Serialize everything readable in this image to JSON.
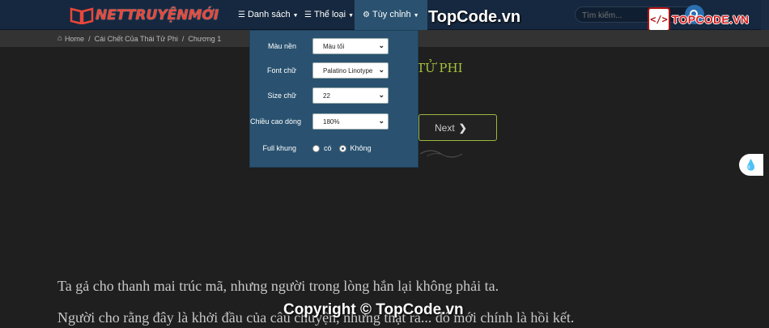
{
  "header": {
    "logo_text": "NETTRUYỆNMỚI",
    "nav": [
      {
        "label": "Danh sách",
        "icon": "list-icon"
      },
      {
        "label": "Thể loại",
        "icon": "list-icon"
      },
      {
        "label": "Tùy chỉnh",
        "icon": "gear-icon"
      }
    ],
    "watermark": "TopCode.vn",
    "search_placeholder": "Tìm kiếm...",
    "brand_badge": "TOPCODE.VN",
    "brand_icon": "</>"
  },
  "breadcrumb": {
    "items": [
      "Home",
      "Cái Chết Của Thái Tử Phi",
      "Chương 1"
    ],
    "separator": "/"
  },
  "settings_panel": {
    "rows": [
      {
        "label": "Màu nền",
        "value": "Màu tối"
      },
      {
        "label": "Font chữ",
        "value": "Palatino Linotype"
      },
      {
        "label": "Size chữ",
        "value": "22"
      },
      {
        "label": "Chiều cao dòng",
        "value": "180%"
      }
    ],
    "full_frame": {
      "label": "Full khung",
      "options": [
        "có",
        "Không"
      ],
      "selected": "Không"
    }
  },
  "content": {
    "title_visible": "TỬ PHI",
    "next_label": "Next",
    "paragraphs": [
      "Ta gả cho thanh mai trúc mã, nhưng người trong lòng hắn lại không phải ta.",
      "Người cho rằng đây là khởi đầu của câu chuyện, nhưng thật ra... đó mới chính là hồi kết."
    ],
    "copyright": "Copyright © TopCode.vn"
  },
  "colors": {
    "nav_bg": "#16283f",
    "panel_bg": "#2a5270",
    "title_accent": "#a6c33b",
    "logo_red": "#e8473a"
  }
}
